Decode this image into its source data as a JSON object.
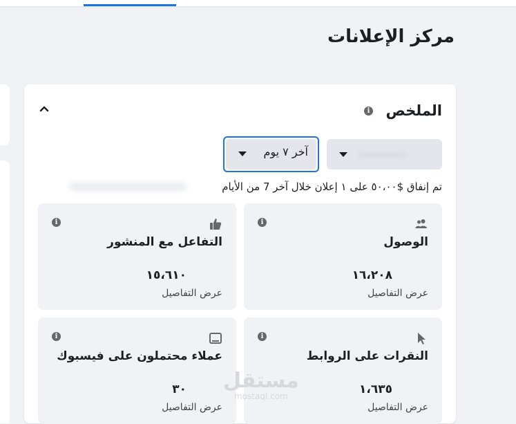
{
  "page": {
    "title": "مركز الإعلانات"
  },
  "summary": {
    "title": "الملخص",
    "date_filter": "آخر ٧ يوم",
    "spend_text": "تم إنفاق $٥٠،٠٠ على ١ إعلان خلال آخر 7 من الأيام"
  },
  "metrics": [
    {
      "label": "الوصول",
      "value": "١٦،٢٠٨",
      "detail": "عرض التفاصيل",
      "icon": "people-icon"
    },
    {
      "label": "التفاعل مع المنشور",
      "value": "١٥،٦١٠",
      "detail": "عرض التفاصيل",
      "icon": "thumbs-up-icon"
    },
    {
      "label": "النقرات على الروابط",
      "value": "١،٦٣٥",
      "detail": "عرض التفاصيل",
      "icon": "cursor-icon"
    },
    {
      "label": "عملاء محتملون على فيسبوك",
      "value": "٣٠",
      "detail": "عرض التفاصيل",
      "icon": "tablet-icon"
    }
  ],
  "watermark": {
    "arabic": "مستقل",
    "latin": "mostaql.com"
  },
  "colors": {
    "accent": "#1b74e4",
    "card_bg": "#f0f2f5",
    "text": "#1c1e21"
  }
}
